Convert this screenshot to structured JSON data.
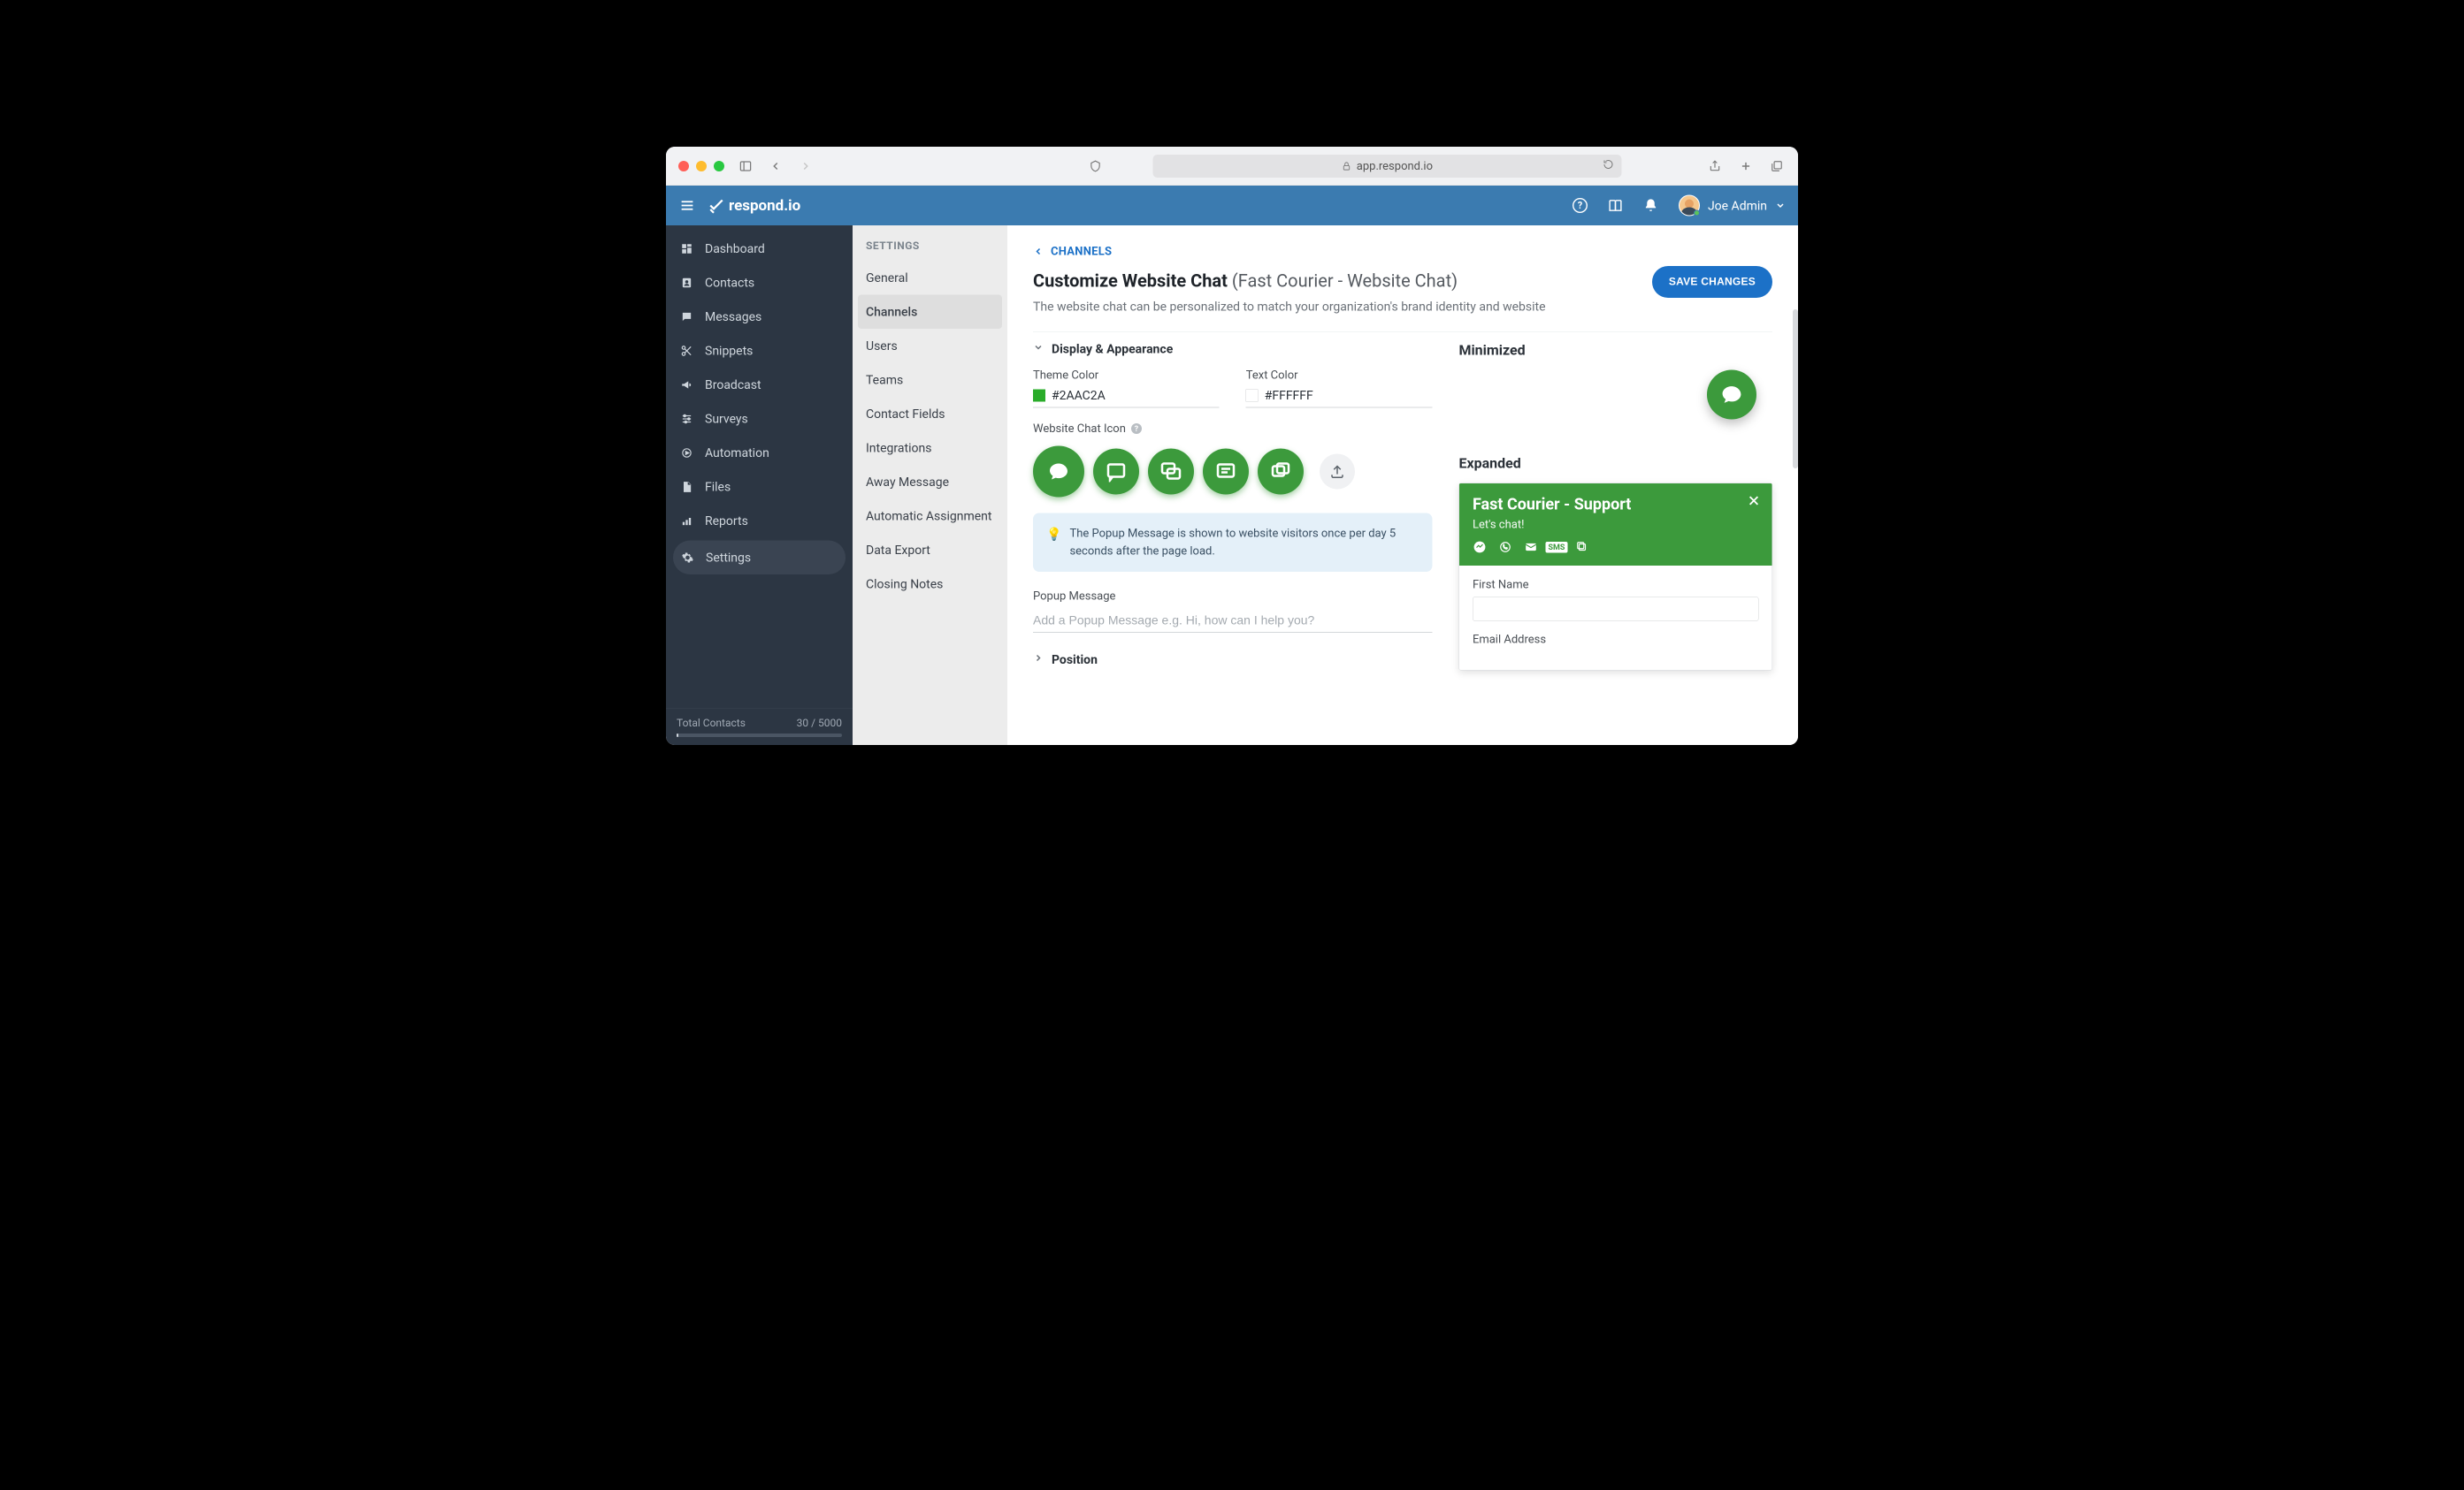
{
  "browser": {
    "url_label": "app.respond.io"
  },
  "header": {
    "brand": "respond.io",
    "user_name": "Joe Admin"
  },
  "sidebar1": {
    "items": [
      {
        "label": "Dashboard",
        "icon": "dashboard-icon"
      },
      {
        "label": "Contacts",
        "icon": "contact-icon"
      },
      {
        "label": "Messages",
        "icon": "message-icon"
      },
      {
        "label": "Snippets",
        "icon": "scissors-icon"
      },
      {
        "label": "Broadcast",
        "icon": "megaphone-icon"
      },
      {
        "label": "Surveys",
        "icon": "sliders-icon"
      },
      {
        "label": "Automation",
        "icon": "gear-play-icon"
      },
      {
        "label": "Files",
        "icon": "file-icon"
      },
      {
        "label": "Reports",
        "icon": "bar-chart-icon"
      },
      {
        "label": "Settings",
        "icon": "gear-icon",
        "active": true
      }
    ],
    "footer_label": "Total Contacts",
    "footer_value": "30 / 5000"
  },
  "sidebar2": {
    "title": "SETTINGS",
    "items": [
      {
        "label": "General"
      },
      {
        "label": "Channels",
        "active": true
      },
      {
        "label": "Users"
      },
      {
        "label": "Teams"
      },
      {
        "label": "Contact Fields"
      },
      {
        "label": "Integrations"
      },
      {
        "label": "Away Message"
      },
      {
        "label": "Automatic Assignment"
      },
      {
        "label": "Data Export"
      },
      {
        "label": "Closing Notes"
      }
    ]
  },
  "main": {
    "breadcrumb": "CHANNELS",
    "title_strong": "Customize Website Chat",
    "title_suffix": "(Fast Courier - Website Chat)",
    "desc": "The website chat can be personalized to match your organization's brand identity and website",
    "save_label": "SAVE CHANGES",
    "section1": "Display & Appearance",
    "theme_label": "Theme Color",
    "theme_value": "#2AAC2A",
    "text_label": "Text Color",
    "text_value": "#FFFFFF",
    "icon_label": "Website Chat Icon",
    "info_text": "The Popup Message is shown to website visitors once per day 5 seconds after the page load.",
    "popup_label": "Popup Message",
    "popup_placeholder": "Add a Popup Message e.g. Hi, how can I help you?",
    "section2": "Position"
  },
  "preview": {
    "min_title": "Minimized",
    "exp_title": "Expanded",
    "widget_title": "Fast Courier - Support",
    "widget_sub": "Let's chat!",
    "field_first": "First Name",
    "field_email": "Email Address"
  },
  "colors": {
    "theme": "#2AAC2A",
    "text": "#FFFFFF"
  }
}
